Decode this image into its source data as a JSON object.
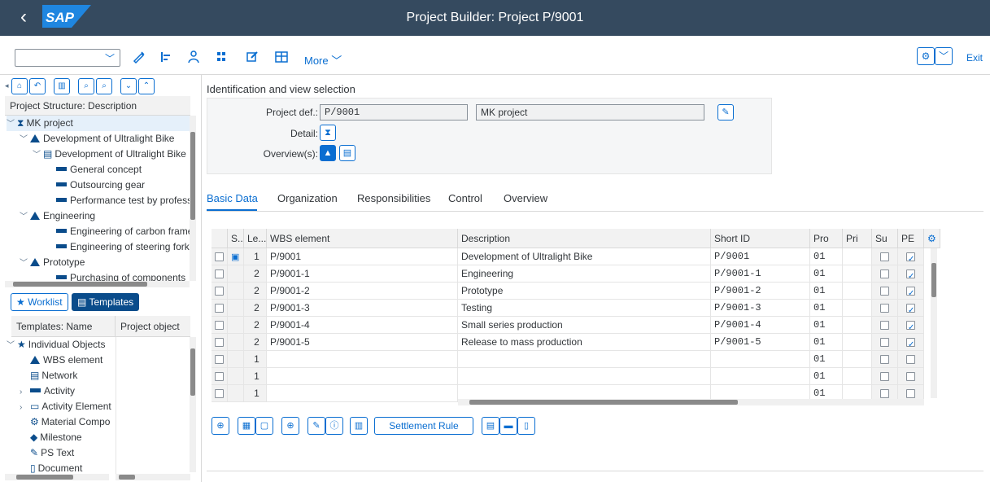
{
  "shell": {
    "back": "‹",
    "logo": "SAP",
    "title": "Project Builder: Project P/9001"
  },
  "toolbar": {
    "select_value": "",
    "more": "More",
    "exit": "Exit"
  },
  "left": {
    "structure_header": "Project Structure: Description",
    "tree": [
      {
        "label": "MK project",
        "icon": "hierarchy-icon",
        "expand": "﹀",
        "indent": 0,
        "selected": true
      },
      {
        "label": "Development of Ultralight Bike",
        "icon": "wbs-triangle-icon",
        "expand": "﹀",
        "indent": 1
      },
      {
        "label": "Development of Ultralight Bike",
        "icon": "network-icon",
        "expand": "﹀",
        "indent": 2
      },
      {
        "label": "General concept",
        "icon": "activity-bar-icon",
        "expand": "",
        "indent": 3
      },
      {
        "label": "Outsourcing gear",
        "icon": "activity-bar-icon",
        "expand": "",
        "indent": 3
      },
      {
        "label": "Performance test by professi",
        "icon": "activity-bar-icon",
        "expand": "",
        "indent": 3
      },
      {
        "label": "Engineering",
        "icon": "wbs-triangle-icon",
        "expand": "﹀",
        "indent": 1
      },
      {
        "label": "Engineering of carbon frame",
        "icon": "activity-bar-icon",
        "expand": "",
        "indent": 3
      },
      {
        "label": "Engineering of steering fork",
        "icon": "activity-bar-icon",
        "expand": "",
        "indent": 3
      },
      {
        "label": "Prototype",
        "icon": "wbs-triangle-icon",
        "expand": "﹀",
        "indent": 1
      },
      {
        "label": "Purchasing of components",
        "icon": "activity-bar-icon",
        "expand": "",
        "indent": 3
      }
    ],
    "worklist": "Worklist",
    "templates": "Templates",
    "templates_header_name": "Templates: Name",
    "templates_header_obj": "Project object",
    "template_items": [
      {
        "label": "Individual Objects",
        "icon": "star-icon",
        "expand": "﹀",
        "indent": 0
      },
      {
        "label": "WBS element",
        "icon": "wbs-triangle-icon",
        "expand": "",
        "indent": 1
      },
      {
        "label": "Network",
        "icon": "network-icon",
        "expand": "",
        "indent": 1
      },
      {
        "label": "Activity",
        "icon": "activity-bar-icon",
        "expand": "›",
        "indent": 1
      },
      {
        "label": "Activity Element",
        "icon": "activity-element-icon",
        "expand": "›",
        "indent": 1
      },
      {
        "label": "Material Compo",
        "icon": "material-component-icon",
        "expand": "",
        "indent": 1
      },
      {
        "label": "Milestone",
        "icon": "milestone-icon",
        "expand": "",
        "indent": 1
      },
      {
        "label": "PS Text",
        "icon": "ps-text-icon",
        "expand": "",
        "indent": 1
      },
      {
        "label": "Document",
        "icon": "document-icon",
        "expand": "",
        "indent": 1
      }
    ]
  },
  "ident": {
    "section_title": "Identification and view selection",
    "project_def_label": "Project def.:",
    "project_def_value": "P/9001",
    "project_desc": "MK project",
    "detail_label": "Detail:",
    "overview_label": "Overview(s):"
  },
  "tabs": [
    "Basic Data",
    "Organization",
    "Responsibilities",
    "Control",
    "Overview"
  ],
  "table": {
    "headers": {
      "s": "S...",
      "le": "Le...",
      "wbs": "WBS element",
      "desc": "Description",
      "short": "Short ID",
      "pro": "Pro",
      "pri": "Pri",
      "su": "Su",
      "pe": "PE"
    },
    "rows": [
      {
        "le": "1",
        "wbs": "P/9001",
        "desc": "Development of Ultralight Bike",
        "short": "P/9001",
        "pro": "01",
        "pri": "",
        "su": false,
        "pe": true,
        "icon": true
      },
      {
        "le": "2",
        "wbs": "P/9001-1",
        "desc": "Engineering",
        "short": "P/9001-1",
        "pro": "01",
        "pri": "",
        "su": false,
        "pe": true
      },
      {
        "le": "2",
        "wbs": "P/9001-2",
        "desc": "Prototype",
        "short": "P/9001-2",
        "pro": "01",
        "pri": "",
        "su": false,
        "pe": true
      },
      {
        "le": "2",
        "wbs": "P/9001-3",
        "desc": "Testing",
        "short": "P/9001-3",
        "pro": "01",
        "pri": "",
        "su": false,
        "pe": true
      },
      {
        "le": "2",
        "wbs": "P/9001-4",
        "desc": "Small series production",
        "short": "P/9001-4",
        "pro": "01",
        "pri": "",
        "su": false,
        "pe": true
      },
      {
        "le": "2",
        "wbs": "P/9001-5",
        "desc": "Release to mass production",
        "short": "P/9001-5",
        "pro": "01",
        "pri": "",
        "su": false,
        "pe": true
      },
      {
        "le": "1",
        "wbs": "",
        "desc": "",
        "short": "",
        "pro": "01",
        "pri": "",
        "su": false,
        "pe": false
      },
      {
        "le": "1",
        "wbs": "",
        "desc": "",
        "short": "",
        "pro": "01",
        "pri": "",
        "su": false,
        "pe": false
      },
      {
        "le": "1",
        "wbs": "",
        "desc": "",
        "short": "",
        "pro": "01",
        "pri": "",
        "su": false,
        "pe": false
      }
    ]
  },
  "bottom": {
    "settlement_rule": "Settlement Rule"
  },
  "colors": {
    "shell": "#354a5f",
    "accent": "#0a6ed1",
    "dark_accent": "#0a4c8b"
  }
}
